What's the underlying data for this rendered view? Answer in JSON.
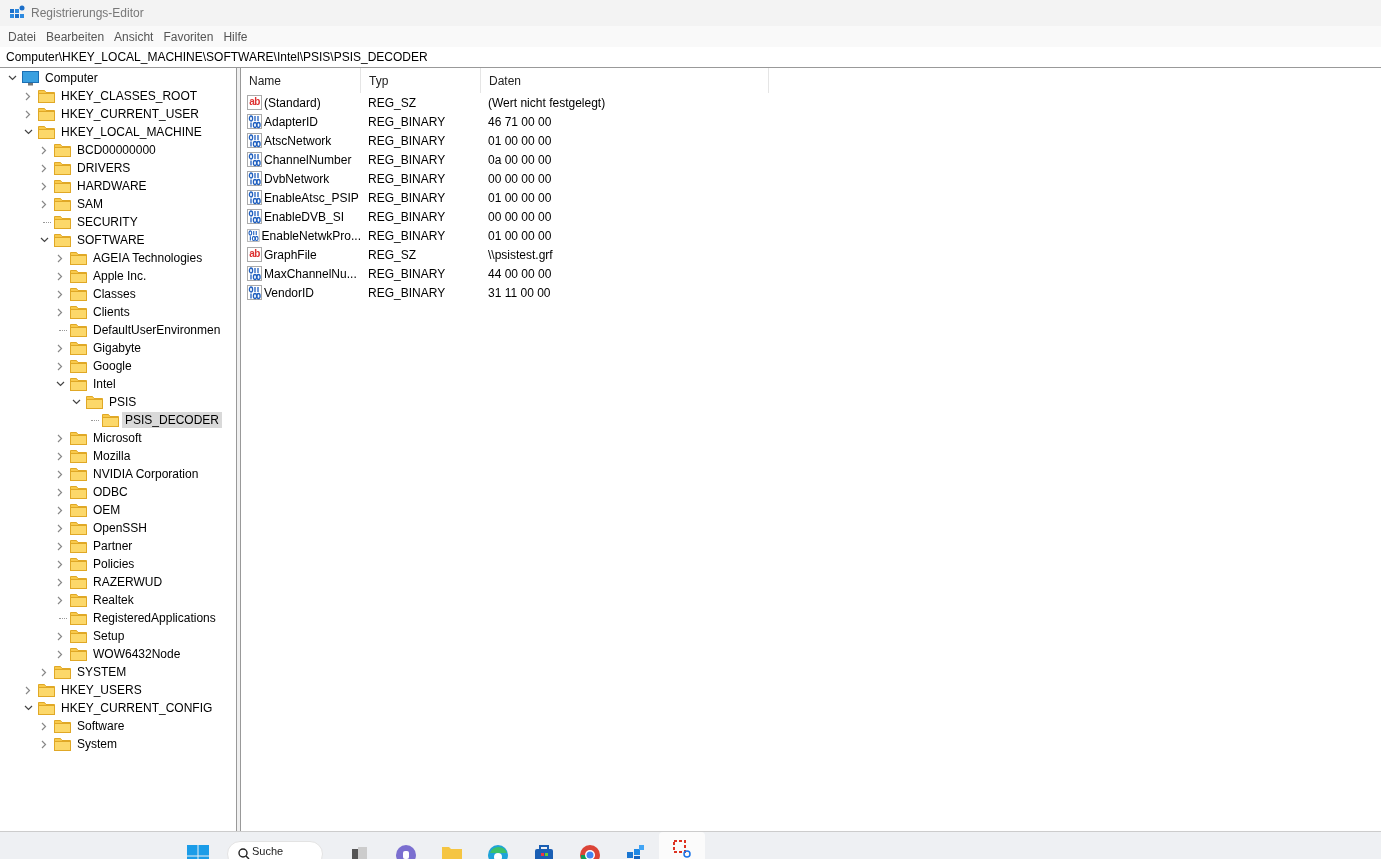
{
  "window": {
    "title": "Registrierungs-Editor"
  },
  "menu": [
    "Datei",
    "Bearbeiten",
    "Ansicht",
    "Favoriten",
    "Hilfe"
  ],
  "address": "Computer\\HKEY_LOCAL_MACHINE\\SOFTWARE\\Intel\\PSIS\\PSIS_DECODER",
  "tree": [
    {
      "label": "Computer",
      "kind": "computer",
      "expanded": true,
      "selected": false,
      "children": [
        {
          "label": "HKEY_CLASSES_ROOT",
          "kind": "branch",
          "expanded": false,
          "selected": false
        },
        {
          "label": "HKEY_CURRENT_USER",
          "kind": "branch",
          "expanded": false,
          "selected": false
        },
        {
          "label": "HKEY_LOCAL_MACHINE",
          "kind": "branch",
          "expanded": true,
          "selected": false,
          "children": [
            {
              "label": "BCD00000000",
              "kind": "branch",
              "expanded": false,
              "selected": false
            },
            {
              "label": "DRIVERS",
              "kind": "branch",
              "expanded": false,
              "selected": false
            },
            {
              "label": "HARDWARE",
              "kind": "branch",
              "expanded": false,
              "selected": false
            },
            {
              "label": "SAM",
              "kind": "branch",
              "expanded": false,
              "selected": false
            },
            {
              "label": "SECURITY",
              "kind": "leaf",
              "selected": false
            },
            {
              "label": "SOFTWARE",
              "kind": "branch",
              "expanded": true,
              "selected": false,
              "children": [
                {
                  "label": "AGEIA Technologies",
                  "kind": "branch",
                  "expanded": false,
                  "selected": false
                },
                {
                  "label": "Apple Inc.",
                  "kind": "branch",
                  "expanded": false,
                  "selected": false
                },
                {
                  "label": "Classes",
                  "kind": "branch",
                  "expanded": false,
                  "selected": false
                },
                {
                  "label": "Clients",
                  "kind": "branch",
                  "expanded": false,
                  "selected": false
                },
                {
                  "label": "DefaultUserEnvironmen",
                  "kind": "leaf",
                  "selected": false
                },
                {
                  "label": "Gigabyte",
                  "kind": "branch",
                  "expanded": false,
                  "selected": false
                },
                {
                  "label": "Google",
                  "kind": "branch",
                  "expanded": false,
                  "selected": false
                },
                {
                  "label": "Intel",
                  "kind": "branch",
                  "expanded": true,
                  "selected": false,
                  "children": [
                    {
                      "label": "PSIS",
                      "kind": "branch",
                      "expanded": true,
                      "selected": false,
                      "children": [
                        {
                          "label": "PSIS_DECODER",
                          "kind": "leaf",
                          "selected": true
                        }
                      ]
                    }
                  ]
                },
                {
                  "label": "Microsoft",
                  "kind": "branch",
                  "expanded": false,
                  "selected": false
                },
                {
                  "label": "Mozilla",
                  "kind": "branch",
                  "expanded": false,
                  "selected": false
                },
                {
                  "label": "NVIDIA Corporation",
                  "kind": "branch",
                  "expanded": false,
                  "selected": false
                },
                {
                  "label": "ODBC",
                  "kind": "branch",
                  "expanded": false,
                  "selected": false
                },
                {
                  "label": "OEM",
                  "kind": "branch",
                  "expanded": false,
                  "selected": false
                },
                {
                  "label": "OpenSSH",
                  "kind": "branch",
                  "expanded": false,
                  "selected": false
                },
                {
                  "label": "Partner",
                  "kind": "branch",
                  "expanded": false,
                  "selected": false
                },
                {
                  "label": "Policies",
                  "kind": "branch",
                  "expanded": false,
                  "selected": false
                },
                {
                  "label": "RAZERWUD",
                  "kind": "branch",
                  "expanded": false,
                  "selected": false
                },
                {
                  "label": "Realtek",
                  "kind": "branch",
                  "expanded": false,
                  "selected": false
                },
                {
                  "label": "RegisteredApplications",
                  "kind": "leaf",
                  "selected": false
                },
                {
                  "label": "Setup",
                  "kind": "branch",
                  "expanded": false,
                  "selected": false
                },
                {
                  "label": "WOW6432Node",
                  "kind": "branch",
                  "expanded": false,
                  "selected": false
                }
              ]
            },
            {
              "label": "SYSTEM",
              "kind": "branch",
              "expanded": false,
              "selected": false
            }
          ]
        },
        {
          "label": "HKEY_USERS",
          "kind": "branch",
          "expanded": false,
          "selected": false
        },
        {
          "label": "HKEY_CURRENT_CONFIG",
          "kind": "branch",
          "expanded": true,
          "selected": false,
          "children": [
            {
              "label": "Software",
              "kind": "branch",
              "expanded": false,
              "selected": false
            },
            {
              "label": "System",
              "kind": "branch",
              "expanded": false,
              "selected": false
            }
          ]
        }
      ]
    }
  ],
  "table": {
    "columns": [
      "Name",
      "Typ",
      "Daten"
    ],
    "rows": [
      {
        "kind": "string",
        "icon_text": "ab",
        "name": "(Standard)",
        "type": "REG_SZ",
        "data": "(Wert nicht festgelegt)"
      },
      {
        "kind": "binary",
        "name": "AdapterID",
        "type": "REG_BINARY",
        "data": "46 71 00 00"
      },
      {
        "kind": "binary",
        "name": "AtscNetwork",
        "type": "REG_BINARY",
        "data": "01 00 00 00"
      },
      {
        "kind": "binary",
        "name": "ChannelNumber",
        "type": "REG_BINARY",
        "data": "0a 00 00 00"
      },
      {
        "kind": "binary",
        "name": "DvbNetwork",
        "type": "REG_BINARY",
        "data": "00 00 00 00"
      },
      {
        "kind": "binary",
        "name": "EnableAtsc_PSIP",
        "type": "REG_BINARY",
        "data": "01 00 00 00"
      },
      {
        "kind": "binary",
        "name": "EnableDVB_SI",
        "type": "REG_BINARY",
        "data": "00 00 00 00"
      },
      {
        "kind": "binary",
        "name": "EnableNetwkPro...",
        "type": "REG_BINARY",
        "data": "01 00 00 00"
      },
      {
        "kind": "string",
        "icon_text": "ab",
        "name": "GraphFile",
        "type": "REG_SZ",
        "data": "\\\\psistest.grf"
      },
      {
        "kind": "binary",
        "name": "MaxChannelNu...",
        "type": "REG_BINARY",
        "data": "44 00 00 00"
      },
      {
        "kind": "binary",
        "name": "VendorID",
        "type": "REG_BINARY",
        "data": "31 11 00 00"
      }
    ]
  },
  "taskbar": {
    "search": {
      "placeholder": "Suche"
    },
    "apps": [
      {
        "kind": "gallery"
      },
      {
        "kind": "chat"
      },
      {
        "kind": "folder"
      },
      {
        "kind": "browser"
      },
      {
        "kind": "store"
      },
      {
        "kind": "chrome"
      },
      {
        "kind": "cubes"
      },
      {
        "kind": "snip",
        "selected": true
      }
    ]
  }
}
